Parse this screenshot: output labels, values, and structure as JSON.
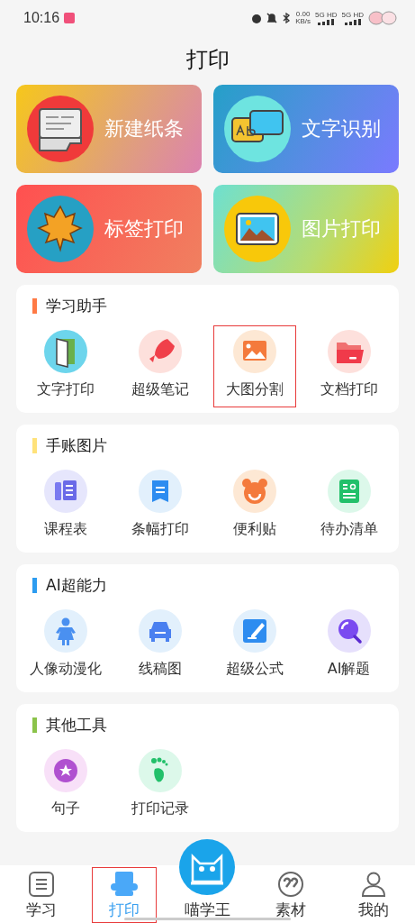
{
  "status_bar": {
    "time": "10:16",
    "speed_value": "0.00",
    "speed_unit": "KB/s",
    "networks": [
      "5G HD",
      "5G HD"
    ]
  },
  "title": "打印",
  "feature_cards": [
    {
      "label": "新建纸条",
      "kind": "note"
    },
    {
      "label": "文字识别",
      "kind": "ocr"
    },
    {
      "label": "标签打印",
      "kind": "leaf"
    },
    {
      "label": "图片打印",
      "kind": "photo"
    }
  ],
  "sections": [
    {
      "title": "学习助手",
      "color": "#ff7a45",
      "items": [
        {
          "label": "文字打印",
          "highlighted": false
        },
        {
          "label": "超级笔记",
          "highlighted": false
        },
        {
          "label": "大图分割",
          "highlighted": true
        },
        {
          "label": "文档打印",
          "highlighted": false
        }
      ]
    },
    {
      "title": "手账图片",
      "color": "#ffe27a",
      "items": [
        {
          "label": "课程表",
          "highlighted": false
        },
        {
          "label": "条幅打印",
          "highlighted": false
        },
        {
          "label": "便利贴",
          "highlighted": false
        },
        {
          "label": "待办清单",
          "highlighted": false
        }
      ]
    },
    {
      "title": "AI超能力",
      "color": "#2d9cf0",
      "items": [
        {
          "label": "人像动漫化",
          "highlighted": false
        },
        {
          "label": "线稿图",
          "highlighted": false
        },
        {
          "label": "超级公式",
          "highlighted": false
        },
        {
          "label": "AI解题",
          "highlighted": false
        }
      ]
    },
    {
      "title": "其他工具",
      "color": "#8bc34a",
      "items": [
        {
          "label": "句子",
          "highlighted": false
        },
        {
          "label": "打印记录",
          "highlighted": false
        }
      ]
    }
  ],
  "nav": [
    {
      "label": "学习",
      "kind": "list",
      "selected": false,
      "highlighted": false
    },
    {
      "label": "打印",
      "kind": "printer",
      "selected": true,
      "highlighted": true
    },
    {
      "label": "喵学王",
      "kind": "cat",
      "selected": false,
      "highlighted": false
    },
    {
      "label": "素材",
      "kind": "quote",
      "selected": false,
      "highlighted": false
    },
    {
      "label": "我的",
      "kind": "user",
      "selected": false,
      "highlighted": false
    }
  ]
}
